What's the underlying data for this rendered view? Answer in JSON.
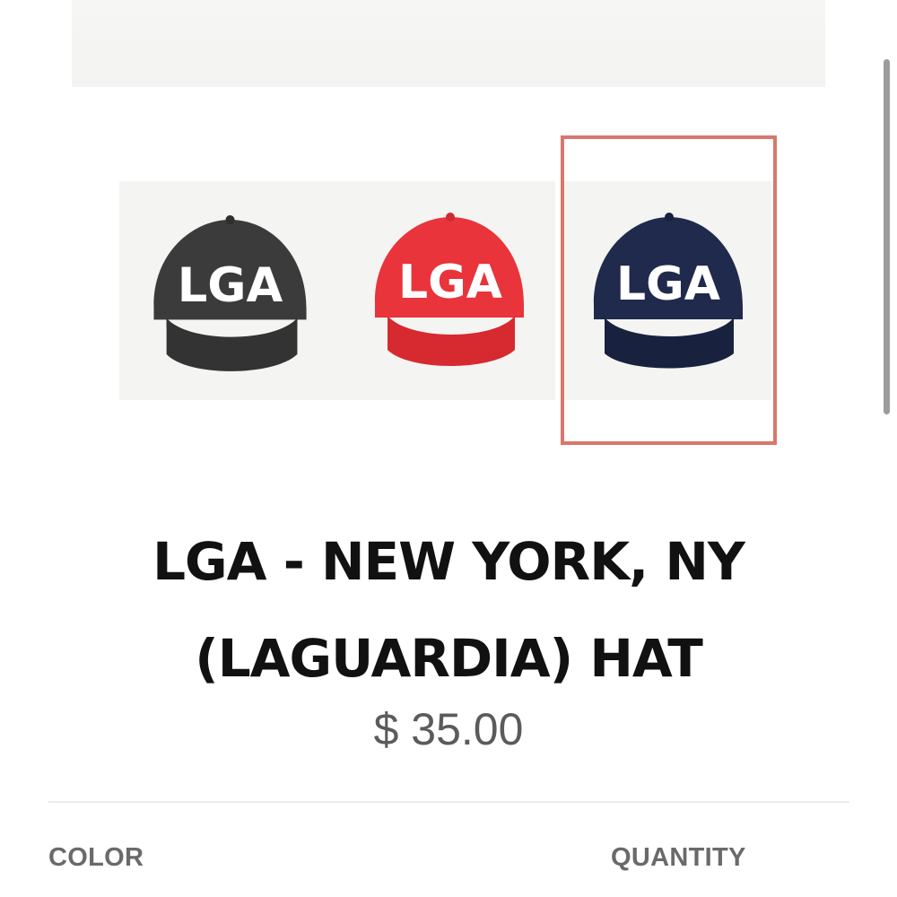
{
  "gallery": {
    "thumbnails": [
      {
        "alt": "LGA",
        "cap_color": "#3b3b3b",
        "brim_color": "#2e2e2e",
        "selected": false
      },
      {
        "alt": "LGA",
        "cap_color": "#e8343a",
        "brim_color": "#d62a30",
        "selected": false
      },
      {
        "alt": "LGA",
        "cap_color": "#1f2a4c",
        "brim_color": "#18213d",
        "selected": true
      }
    ],
    "selected_border_color": "#d9776c"
  },
  "product": {
    "title_line1": "LGA - NEW YORK, NY",
    "title_line2": "(LAGUARDIA) HAT",
    "price": "$ 35.00"
  },
  "options": {
    "color_label": "COLOR",
    "quantity_label": "QUANTITY"
  }
}
